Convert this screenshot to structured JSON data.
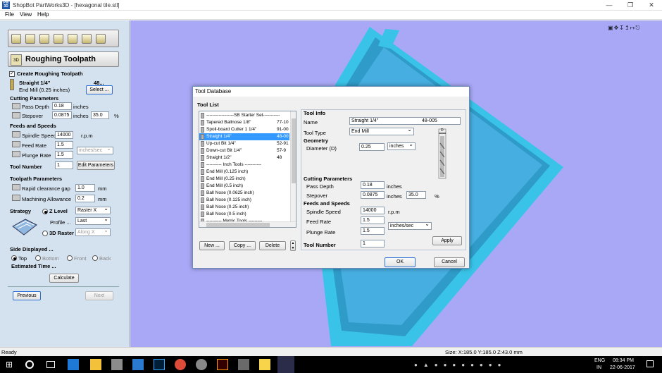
{
  "window": {
    "title": "ShopBot PartWorks3D - [hexagonal tile.stl]",
    "app_icon_text": "PW 3D"
  },
  "menu": [
    "File",
    "View",
    "Help"
  ],
  "left": {
    "section_title": "Roughing Toolpath",
    "create_label": "Create Roughing Toolpath",
    "tool_name": "Straight 1/4\"",
    "tool_num": "48...",
    "tool_desc": "End Mill (0.25 inches)",
    "select_btn": "Select ...",
    "cutting_params": "Cutting Parameters",
    "pass_depth_label": "Pass Depth",
    "pass_depth": "0.18",
    "pass_depth_unit": "inches",
    "stepover_label": "Stepover",
    "stepover": "0.0875",
    "stepover_unit": "inches",
    "stepover_pct": "35.0",
    "pct": "%",
    "feeds_speeds": "Feeds and Speeds",
    "spindle_label": "Spindle Speed",
    "spindle": "14000",
    "spindle_unit": "r.p.m",
    "feed_label": "Feed Rate",
    "feed": "1.5",
    "feed_unit": "inches/sec",
    "plunge_label": "Plunge Rate",
    "plunge": "1.5",
    "tool_number_label": "Tool Number",
    "tool_number": "1",
    "edit_params_btn": "Edit Parameters",
    "toolpath_params": "Toolpath Parameters",
    "rapid_label": "Rapid clearance gap",
    "rapid": "1.0",
    "rapid_unit": "mm",
    "allowance_label": "Machining Allowance",
    "allowance": "0.2",
    "allowance_unit": "mm",
    "strategy_label": "Strategy",
    "zlevel_label": "Z Level",
    "zlevel_value": "Raster X",
    "profile_label": "Profile ...",
    "profile_value": "Last",
    "raster3d_label": "3D Raster",
    "raster3d_value": "Along X",
    "side_label": "Side Displayed ...",
    "sides": [
      "Top",
      "Bottom",
      "Front",
      "Back"
    ],
    "est_time": "Estimated Time ...",
    "calculate_btn": "Calculate",
    "previous_btn": "Previous",
    "next_btn": "Next"
  },
  "dialog": {
    "title": "Tool Database",
    "tool_list_label": "Tool List",
    "tools": [
      {
        "name": "------------------SB Starter Set-----------",
        "num": ""
      },
      {
        "name": "Tapered Ballnose   1/8\"",
        "num": "77-10"
      },
      {
        "name": "Spoil-board Cutter  1 1/4\"",
        "num": "91-00"
      },
      {
        "name": "Straight 1/4\"",
        "num": "48-00"
      },
      {
        "name": "Up-cut Bit 1/4\"",
        "num": "52-91"
      },
      {
        "name": "Down-cut Bit 1/4\"",
        "num": "57-9"
      },
      {
        "name": "Straight 1/2\"",
        "num": "48"
      },
      {
        "name": "---------- Inch Tools -----------",
        "num": ""
      },
      {
        "name": "End Mill (0.125 inch)",
        "num": ""
      },
      {
        "name": "End Mill (0.25 inch)",
        "num": ""
      },
      {
        "name": "End Mill (0.5 inch)",
        "num": ""
      },
      {
        "name": "Ball Nose (0.0625 inch)",
        "num": ""
      },
      {
        "name": "Ball Nose (0.125 inch)",
        "num": ""
      },
      {
        "name": "Ball Nose (0.25 inch)",
        "num": ""
      },
      {
        "name": "Ball Nose (0.5 inch)",
        "num": ""
      },
      {
        "name": "---------- Metric Tools ---------",
        "num": ""
      }
    ],
    "selected_index": 3,
    "new_btn": "New ...",
    "copy_btn": "Copy ...",
    "delete_btn": "Delete",
    "tool_info": "Tool Info",
    "name_label": "Name",
    "name_value": "Straight 1/4\"",
    "name_num": "48-005",
    "type_label": "Tool Type",
    "type_value": "End Mill",
    "geometry": "Geometry",
    "diameter_label": "Diameter (D)",
    "diameter": "0.25",
    "diameter_unit": "inches",
    "cutting_params": "Cutting Parameters",
    "pass_depth_label": "Pass Depth",
    "pass_depth": "0.18",
    "pass_depth_unit": "inches",
    "stepover_label": "Stepover",
    "stepover": "0.0875",
    "stepover_unit": "inches",
    "stepover_pct": "35.0",
    "pct": "%",
    "feeds_speeds": "Feeds and Speeds",
    "spindle_label": "Spindle Speed",
    "spindle": "14000",
    "spindle_unit": "r.p.m",
    "feed_label": "Feed Rate",
    "feed": "1.5",
    "feed_unit": "inches/sec",
    "plunge_label": "Plunge Rate",
    "plunge": "1.5",
    "tool_number_label": "Tool Number",
    "tool_number": "1",
    "apply_btn": "Apply",
    "ok_btn": "OK",
    "cancel_btn": "Cancel",
    "d_marker": "D"
  },
  "status": {
    "left": "Ready",
    "size": "Size: X:185.0 Y:185.0 Z:43.0 mm"
  },
  "taskbar": {
    "lang": "ENG",
    "region": "IN",
    "time": "08:34 PM",
    "date": "22-06-2017"
  },
  "colors": {
    "viewport": "#a8a8f6",
    "tile_face": "#3aa6d8",
    "tile_edge": "#39c3e8",
    "selected": "#3399ff"
  }
}
